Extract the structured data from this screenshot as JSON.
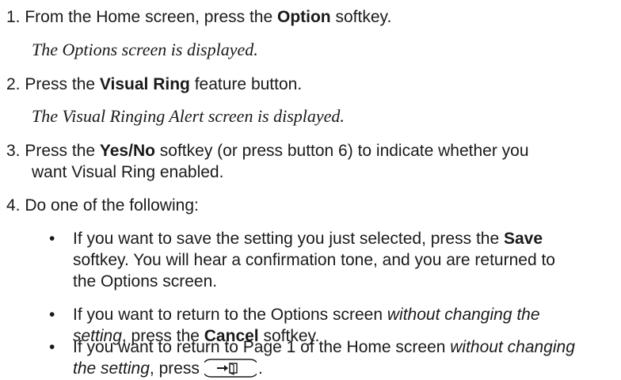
{
  "steps": [
    {
      "number": "1.",
      "text_pre": "From the Home screen, press the ",
      "bold": "Option",
      "text_post": " softkey.",
      "result": "The Options screen is displayed."
    },
    {
      "number": "2.",
      "text_pre": "Press the ",
      "bold": "Visual Ring",
      "text_post": " feature button.",
      "result": "The Visual Ringing Alert screen is displayed."
    },
    {
      "number": "3.",
      "text_pre": "Press the ",
      "bold": "Yes/No",
      "text_post": " softkey (or press button 6) to indicate whether you",
      "continuation": "want Visual Ring enabled."
    },
    {
      "number": "4.",
      "text": "Do one of the following:"
    }
  ],
  "bullets": [
    {
      "symbol": "•",
      "line1_pre": "If you want to save the setting you just selected, press the ",
      "line1_bold": "Save",
      "line2": "softkey. You will hear a confirmation tone, and you are returned to",
      "line3": "the Options screen."
    },
    {
      "symbol": "•",
      "line1_pre": "If you want to return to the Options screen ",
      "line1_italic": "without changing the",
      "line2_italic": "setting",
      "line2_mid": ", press the ",
      "line2_bold": "Cancel",
      "line2_post": " softkey."
    },
    {
      "symbol": "•",
      "line1_pre": "If you want to return to Page 1 of the Home screen ",
      "line1_italic": "without changing",
      "line2_italic": "the setting",
      "line2_post": ", press",
      "line2_end": ".",
      "key_icon": "home-exit-key-icon"
    }
  ]
}
